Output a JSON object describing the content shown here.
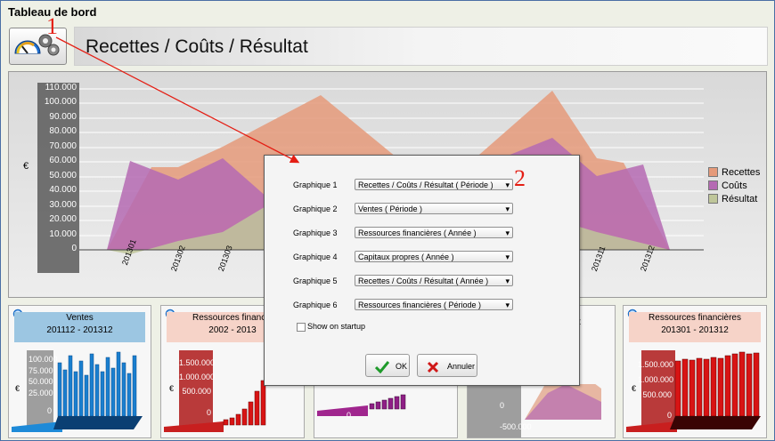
{
  "app": {
    "title": "Tableau de bord"
  },
  "header": {
    "title": "Recettes / Coûts / Résultat"
  },
  "markers": {
    "m1": "1",
    "m2": "2"
  },
  "main_chart": {
    "ylabel": "€",
    "yticks": [
      "110.000",
      "100.000",
      "90.000",
      "80.000",
      "70.000",
      "60.000",
      "50.000",
      "40.000",
      "30.000",
      "20.000",
      "10.000",
      "0"
    ],
    "xticks_left": [
      "201301",
      "201302",
      "201303"
    ],
    "xticks_right": [
      "201311",
      "201312"
    ],
    "legend": [
      {
        "label": "Recettes",
        "color": "#e59a7a"
      },
      {
        "label": "Coûts",
        "color": "#b56ab3"
      },
      {
        "label": "Résultat",
        "color": "#bfc69a"
      }
    ]
  },
  "panels": [
    {
      "title": "Ventes",
      "subtitle": "201112 - 201312",
      "yticks": [
        "100.000",
        "75.000",
        "50.000",
        "25.000",
        "0"
      ],
      "ylabel": "€"
    },
    {
      "title": "Ressources financiè",
      "subtitle": "2002 - 2013",
      "yticks": [
        "1.500.000",
        "1.000.000",
        "500.000",
        "0"
      ],
      "ylabel": "€"
    },
    {
      "title": "",
      "subtitle": "",
      "yticks": [
        "0"
      ],
      "ylabel": ""
    },
    {
      "title": "t",
      "subtitle": "",
      "yticks": [
        "0",
        "-500.000"
      ],
      "ylabel": ""
    },
    {
      "title": "Ressources financières",
      "subtitle": "201301 - 201312",
      "yticks": [
        "1.500.000",
        "1.000.000",
        "500.000",
        "0"
      ],
      "ylabel": "€"
    }
  ],
  "dialog": {
    "rows": [
      {
        "label": "Graphique 1",
        "value": "Recettes / Coûts / Résultat ( Période )"
      },
      {
        "label": "Graphique 2",
        "value": "Ventes ( Période )"
      },
      {
        "label": "Graphique 3",
        "value": "Ressources financières ( Année )"
      },
      {
        "label": "Graphique 4",
        "value": "Capitaux propres ( Année )"
      },
      {
        "label": "Graphique 5",
        "value": "Recettes / Coûts / Résultat ( Année )"
      },
      {
        "label": "Graphique 6",
        "value": "Ressources financières ( Période )"
      }
    ],
    "checkbox_label": "Show on startup",
    "ok_label": "OK",
    "cancel_label": "Annuler"
  }
}
